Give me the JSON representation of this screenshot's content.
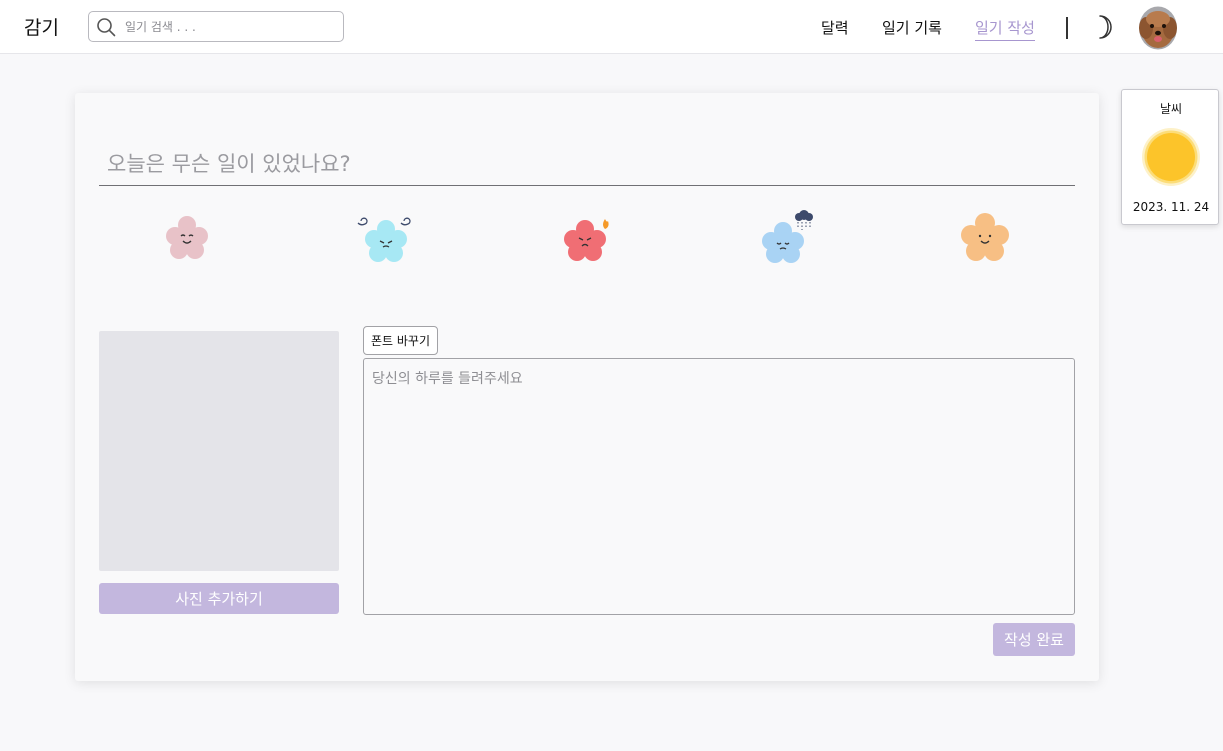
{
  "header": {
    "logo": "감기",
    "search": {
      "placeholder": "일기 검색 . . ."
    },
    "nav": {
      "calendar": "달력",
      "records": "일기 기록",
      "write": "일기 작성"
    }
  },
  "editor": {
    "title_placeholder": "오늘은 무슨 일이 있었나요?",
    "emotions": [
      {
        "icon": "happy-flower-icon",
        "color": "#e8c2c8"
      },
      {
        "icon": "dizzy-flower-icon",
        "color": "#a7e8f4"
      },
      {
        "icon": "angry-flower-icon",
        "color": "#f06e74"
      },
      {
        "icon": "sad-rain-flower-icon",
        "color": "#a9d3f4"
      },
      {
        "icon": "calm-flower-icon",
        "color": "#f7bf84"
      }
    ],
    "photo_button": "사진 추가하기",
    "font_button": "폰트 바꾸기",
    "content_placeholder": "당신의 하루를 들려주세요",
    "submit_button": "작성 완료"
  },
  "weather": {
    "title": "날씨",
    "icon": "sun-icon",
    "date": "2023. 11. 24"
  },
  "colors": {
    "accent": "#c3b7de",
    "nav_active": "#a796cf",
    "sun": "#fcc42a"
  }
}
